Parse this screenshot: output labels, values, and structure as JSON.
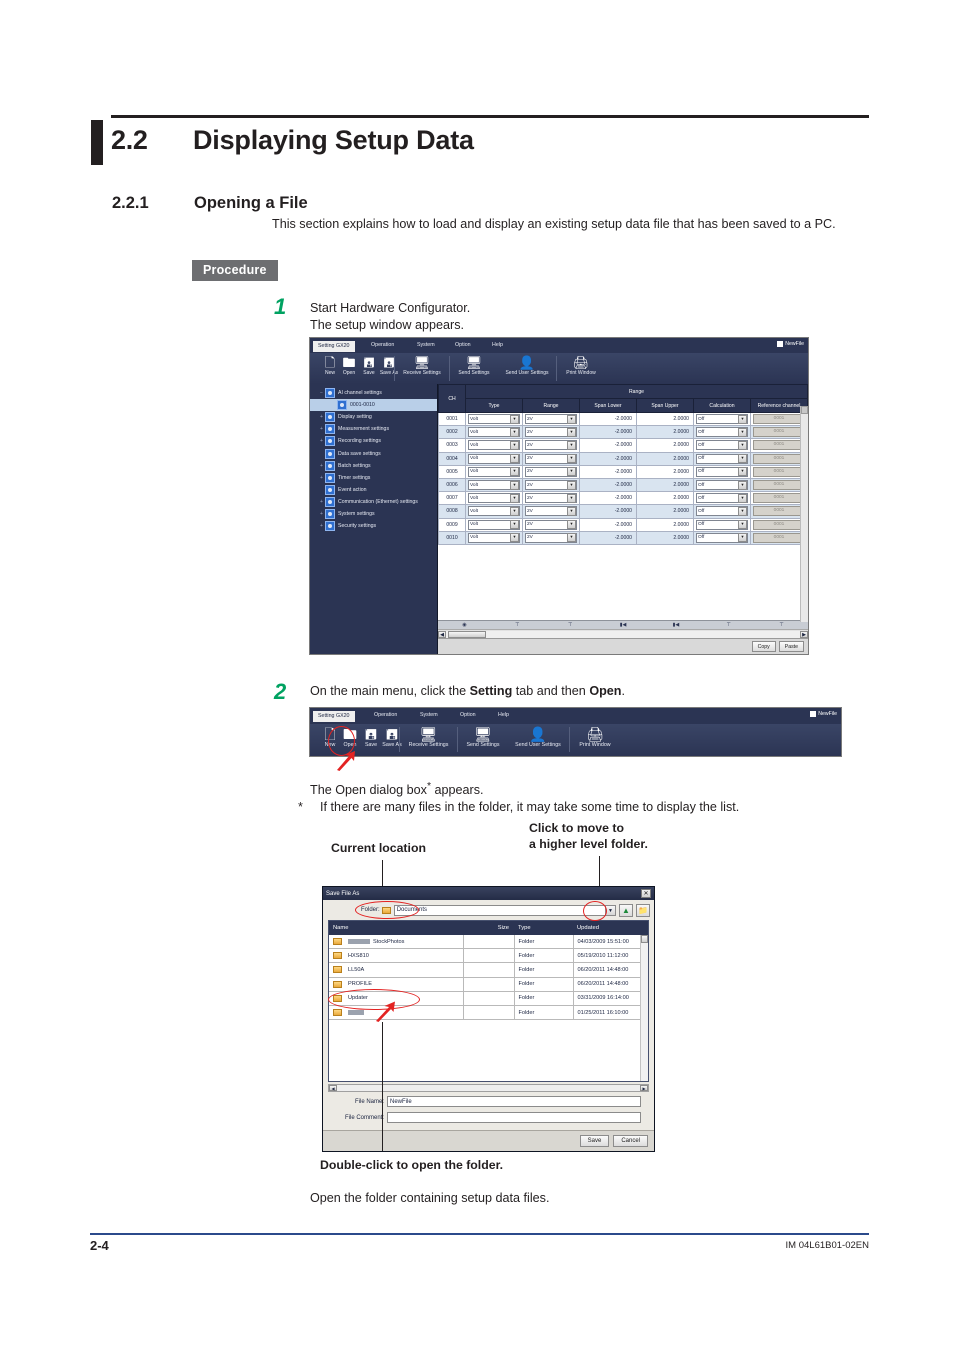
{
  "document": {
    "section_number": "2.2",
    "section_title": "Displaying Setup Data",
    "subsection_number": "2.2.1",
    "subsection_title": "Opening a File",
    "intro": "This section explains how to load and display an existing setup data file that has been saved to a PC.",
    "procedure_badge": "Procedure",
    "footer_page": "2-4",
    "footer_code": "IM 04L61B01-02EN"
  },
  "steps": [
    {
      "number": "1",
      "line1": "Start Hardware Configurator.",
      "line2": "The setup window appears."
    },
    {
      "number": "2",
      "line1_a": "On the main menu, click the ",
      "line1_b": "Setting",
      "line1_c": " tab and then ",
      "line1_d": "Open",
      "line1_e": ".",
      "note1": "The Open dialog box",
      "note1_sup": "*",
      "note1_tail": " appears.",
      "note2_mark": "*",
      "note2": "If there are many files in the folder, it may take some time to display the list."
    }
  ],
  "callouts": {
    "current_location": "Current location",
    "higher_level_line1": "Click to move to",
    "higher_level_line2": "a higher level folder.",
    "double_click": "Double-click to open the folder.",
    "closing": "Open the folder containing setup data files."
  },
  "app": {
    "tabs": [
      "Setting GX20",
      "Operation",
      "System",
      "Option",
      "Help"
    ],
    "active_tab": "Setting GX20",
    "file_tag": "NewFile",
    "ribbon_buttons": [
      {
        "label": "New",
        "icon": "new-document-icon",
        "glyph": "□"
      },
      {
        "label": "Open",
        "icon": "open-folder-icon",
        "glyph": "□"
      },
      {
        "label": "Save",
        "icon": "save-disk-icon",
        "glyph": "□"
      },
      {
        "label": "Save As",
        "icon": "save-as-disk-icon",
        "glyph": "□"
      },
      {
        "label": "Receive Settings",
        "icon": "receive-settings-icon",
        "glyph": "□"
      },
      {
        "label": "Send Settings",
        "icon": "send-settings-icon",
        "glyph": "□"
      },
      {
        "label": "Send User Settings",
        "icon": "send-user-settings-icon",
        "glyph": "□"
      },
      {
        "label": "Print Window",
        "icon": "print-window-icon",
        "glyph": "□"
      }
    ],
    "tree": [
      {
        "label": "AI channel settings",
        "level": 0,
        "expander": "−",
        "selected": false
      },
      {
        "label": "0001-0010",
        "level": 1,
        "expander": "",
        "selected": true
      },
      {
        "label": "Display setting",
        "level": 0,
        "expander": "+",
        "selected": false
      },
      {
        "label": "Measurement settings",
        "level": 0,
        "expander": "+",
        "selected": false
      },
      {
        "label": "Recording settings",
        "level": 0,
        "expander": "+",
        "selected": false
      },
      {
        "label": "Data save settings",
        "level": 0,
        "expander": "",
        "selected": false
      },
      {
        "label": "Batch settings",
        "level": 0,
        "expander": "+",
        "selected": false
      },
      {
        "label": "Timer settings",
        "level": 0,
        "expander": "+",
        "selected": false
      },
      {
        "label": "Event action",
        "level": 0,
        "expander": "",
        "selected": false
      },
      {
        "label": "Communication (Ethernet) settings",
        "level": 0,
        "expander": "+",
        "selected": false
      },
      {
        "label": "System settings",
        "level": 0,
        "expander": "+",
        "selected": false
      },
      {
        "label": "Security settings",
        "level": 0,
        "expander": "+",
        "selected": false
      }
    ],
    "grid": {
      "group_header": "Range",
      "ch_header": "CH",
      "columns": [
        "Type",
        "Range",
        "Span Lower",
        "Span Upper",
        "Calculation",
        "Reference channel"
      ],
      "rows": [
        {
          "ch": "0001",
          "type": "Volt",
          "range": "2V",
          "span_lower": "-2.0000",
          "span_upper": "2.0000",
          "calculation": "Off",
          "reference": "0001"
        },
        {
          "ch": "0002",
          "type": "Volt",
          "range": "2V",
          "span_lower": "-2.0000",
          "span_upper": "2.0000",
          "calculation": "Off",
          "reference": "0001"
        },
        {
          "ch": "0003",
          "type": "Volt",
          "range": "2V",
          "span_lower": "-2.0000",
          "span_upper": "2.0000",
          "calculation": "Off",
          "reference": "0001"
        },
        {
          "ch": "0004",
          "type": "Volt",
          "range": "2V",
          "span_lower": "-2.0000",
          "span_upper": "2.0000",
          "calculation": "Off",
          "reference": "0001"
        },
        {
          "ch": "0005",
          "type": "Volt",
          "range": "2V",
          "span_lower": "-2.0000",
          "span_upper": "2.0000",
          "calculation": "Off",
          "reference": "0001"
        },
        {
          "ch": "0006",
          "type": "Volt",
          "range": "2V",
          "span_lower": "-2.0000",
          "span_upper": "2.0000",
          "calculation": "Off",
          "reference": "0001"
        },
        {
          "ch": "0007",
          "type": "Volt",
          "range": "2V",
          "span_lower": "-2.0000",
          "span_upper": "2.0000",
          "calculation": "Off",
          "reference": "0001"
        },
        {
          "ch": "0008",
          "type": "Volt",
          "range": "2V",
          "span_lower": "-2.0000",
          "span_upper": "2.0000",
          "calculation": "Off",
          "reference": "0001"
        },
        {
          "ch": "0009",
          "type": "Volt",
          "range": "2V",
          "span_lower": "-2.0000",
          "span_upper": "2.0000",
          "calculation": "Off",
          "reference": "0001"
        },
        {
          "ch": "0010",
          "type": "Volt",
          "range": "2V",
          "span_lower": "-2.0000",
          "span_upper": "2.0000",
          "calculation": "Off",
          "reference": "0001"
        }
      ]
    },
    "copy_label": "Copy",
    "paste_label": "Paste"
  },
  "dialog": {
    "title": "Save File As",
    "close_glyph": "✕",
    "folder_label": "Folder:",
    "folder_path": "Documents",
    "up_icon": "move-up-folder-icon",
    "new_folder_icon": "new-folder-icon",
    "columns": [
      "Name",
      "Size",
      "Type",
      "Updated"
    ],
    "rows": [
      {
        "name": "StockPhotos",
        "redacted_prefix": true,
        "size": "",
        "type": "Folder",
        "updated": "04/03/2009 15:51:00"
      },
      {
        "name": "HXS810",
        "redacted_prefix": false,
        "size": "",
        "type": "Folder",
        "updated": "05/19/2010 11:12:00"
      },
      {
        "name": "LL50A",
        "redacted_prefix": false,
        "size": "",
        "type": "Folder",
        "updated": "06/20/2011 14:48:00"
      },
      {
        "name": "PROFILE",
        "redacted_prefix": false,
        "size": "",
        "type": "Folder",
        "updated": "06/20/2011 14:48:00"
      },
      {
        "name": "Updater",
        "redacted_prefix": false,
        "size": "",
        "type": "Folder",
        "updated": "03/31/2009 16:14:00"
      },
      {
        "name": "",
        "redacted_prefix": true,
        "size": "",
        "type": "Folder",
        "updated": "01/25/2011 16:10:00"
      }
    ],
    "file_name_label": "File Name:",
    "file_name_value": "NewFile",
    "file_comment_label": "File Comment:",
    "file_comment_value": "",
    "save_label": "Save",
    "cancel_label": "Cancel"
  },
  "colors": {
    "accent_green": "#00a261",
    "annotation_red": "#e32322",
    "ribbon_navy": "#2b3453",
    "badge_gray": "#6d6e71",
    "footer_blue": "#2b4a8b"
  }
}
